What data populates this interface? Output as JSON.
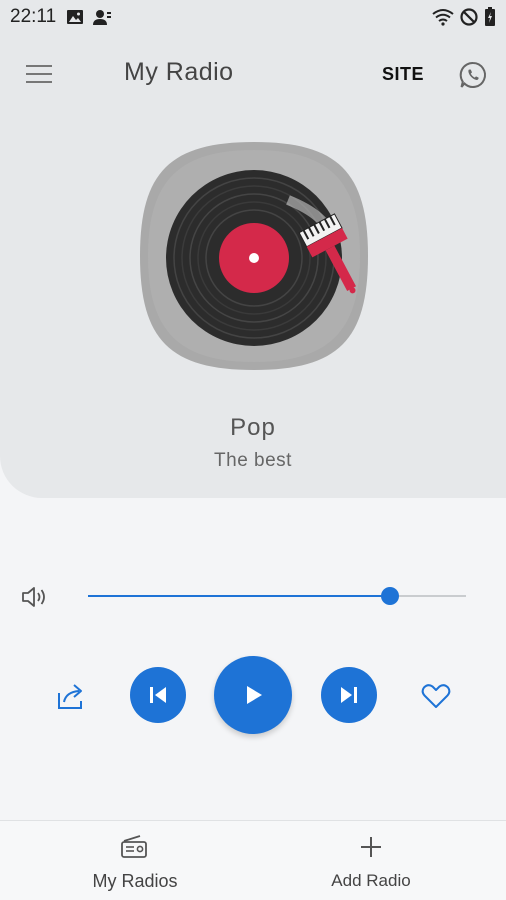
{
  "status_bar": {
    "time": "22:11",
    "left_icons": [
      "image-icon",
      "contact-icon"
    ],
    "right_icons": [
      "wifi-icon",
      "do-not-disturb-icon",
      "battery-icon"
    ]
  },
  "app_bar": {
    "title": "My Radio",
    "site_label": "SITE",
    "menu_icon": "hamburger-menu-icon",
    "whatsapp_icon": "whatsapp-icon"
  },
  "now_playing": {
    "artwork": "vinyl-record-with-paintbrush",
    "station_name": "Pop",
    "station_subtitle": "The best"
  },
  "volume": {
    "icon": "speaker-icon",
    "level": 0.8
  },
  "controls": {
    "share_icon": "share-icon",
    "prev_icon": "skip-previous-icon",
    "play_icon": "play-icon",
    "next_icon": "skip-next-icon",
    "favorite_icon": "heart-icon"
  },
  "bottom_nav": {
    "items": [
      {
        "label": "My Radios",
        "icon": "radio-icon"
      },
      {
        "label": "Add Radio",
        "icon": "plus-icon"
      }
    ]
  },
  "colors": {
    "accent": "#1e73d6",
    "panel": "#e6e8ea",
    "record_label": "#d4294a"
  }
}
